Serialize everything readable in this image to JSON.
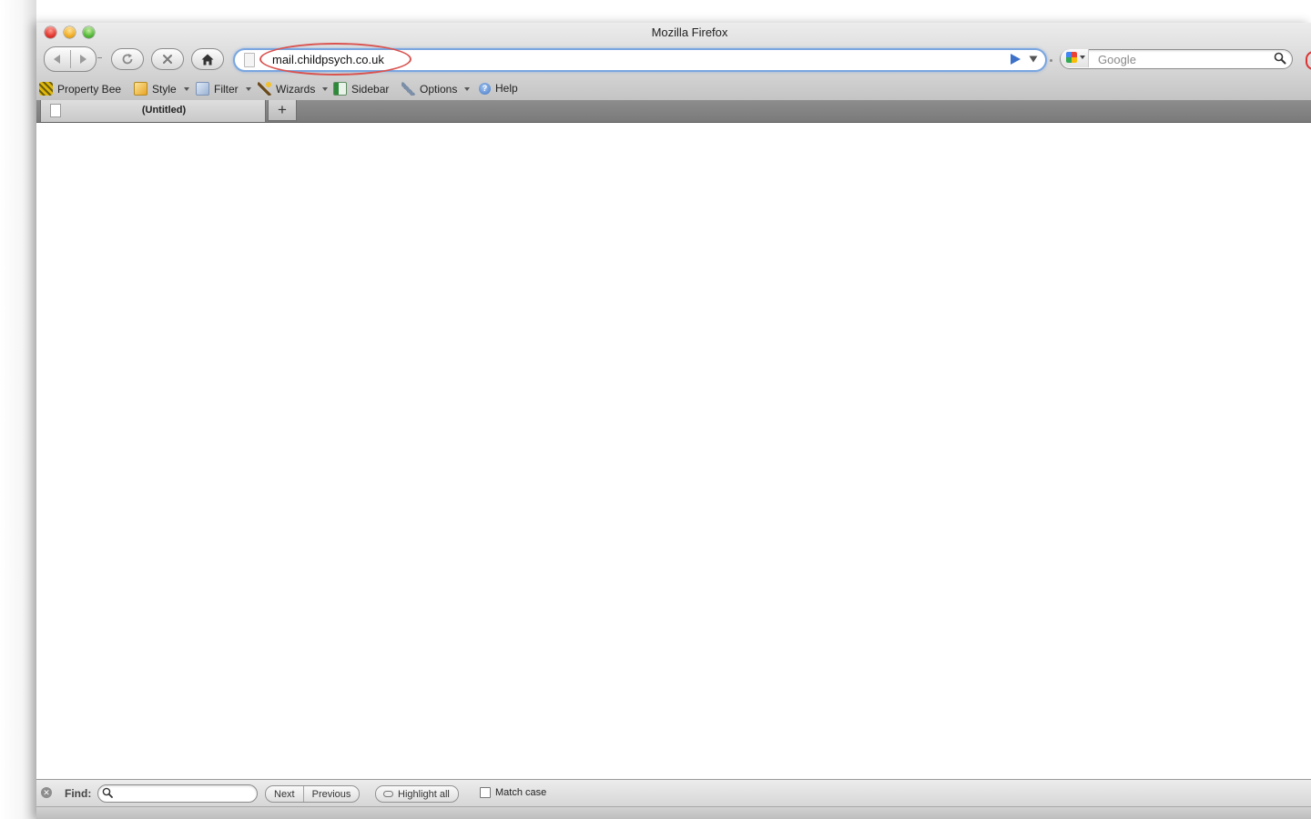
{
  "window": {
    "title": "Mozilla Firefox"
  },
  "toolbar": {
    "url": "mail.childpsych.co.uk",
    "search_placeholder": "Google",
    "search_engine_icon": "google-icon"
  },
  "extension_bar": {
    "items": [
      {
        "label": "Property Bee",
        "icon": "bee-icon"
      },
      {
        "label": "Style",
        "icon": "style-icon",
        "dropdown": true
      },
      {
        "label": "Filter",
        "icon": "filter-icon",
        "dropdown": true
      },
      {
        "label": "Wizards",
        "icon": "wand-icon",
        "dropdown": true
      },
      {
        "label": "Sidebar",
        "icon": "sidebar-icon"
      },
      {
        "label": "Options",
        "icon": "wrench-icon",
        "dropdown": true
      },
      {
        "label": "Help",
        "icon": "help-icon"
      }
    ]
  },
  "tabs": [
    {
      "label": "(Untitled)"
    }
  ],
  "newtab_label": "+",
  "findbar": {
    "label": "Find:",
    "next": "Next",
    "previous": "Previous",
    "highlight_all": "Highlight all",
    "match_case": "Match case"
  },
  "colors": {
    "url_focus": "#7aa6e0",
    "annotation_ring": "#d9534f"
  }
}
